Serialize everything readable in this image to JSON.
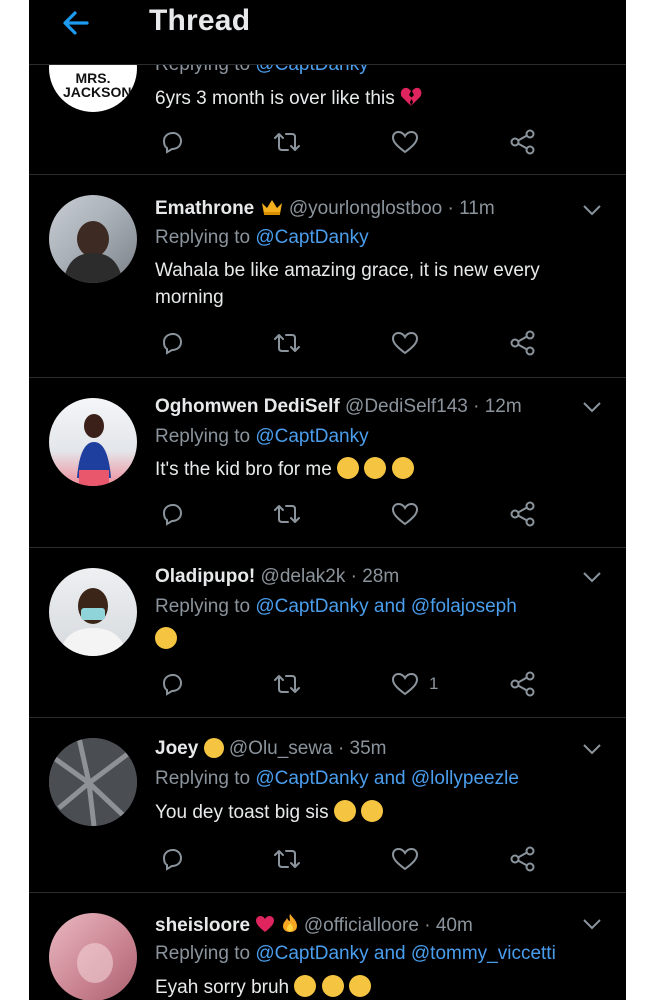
{
  "header": {
    "title": "Thread"
  },
  "tweets": [
    {
      "avatar_text": "MRS. JACKSON",
      "reply_prefix": "Replying to",
      "reply_to": "@CaptDanky",
      "text": "6yrs 3 month is over like this"
    },
    {
      "name": "Emathrone",
      "handle": "@yourlonglostboo",
      "time": "· 11m",
      "reply_prefix": "Replying to",
      "reply_to": "@CaptDanky",
      "text": "Wahala be like amazing grace, it is new every morning"
    },
    {
      "name": "Oghomwen DediSelf",
      "handle": "@DediSelf143",
      "time": "· 12m",
      "reply_prefix": "Replying to",
      "reply_to": "@CaptDanky",
      "text": "It's the kid bro for me"
    },
    {
      "name": "Oladipupo!",
      "handle": "@delak2k",
      "time": "· 28m",
      "reply_prefix": "Replying to",
      "reply_to": "@CaptDanky and @folajoseph",
      "like_count": "1"
    },
    {
      "name": "Joey",
      "handle": "@Olu_sewa",
      "time": "· 35m",
      "reply_prefix": "Replying to",
      "reply_to": "@CaptDanky and @lollypeezle",
      "text": "You dey toast big sis"
    },
    {
      "name": "sheisloore",
      "handle": "@officialloore",
      "time": "· 40m",
      "reply_prefix": "Replying to",
      "reply_to": "@CaptDanky and @tommy_viccetti",
      "text": "Eyah sorry bruh"
    }
  ],
  "icons": [
    "back-arrow-icon",
    "reply-icon",
    "retweet-icon",
    "like-icon",
    "share-icon",
    "chevron-down-icon"
  ],
  "colors": {
    "background": "#000000",
    "link": "#4a9eed",
    "muted": "#8b949c",
    "text": "#e7e9ea",
    "accent": "#1d9bf0"
  }
}
